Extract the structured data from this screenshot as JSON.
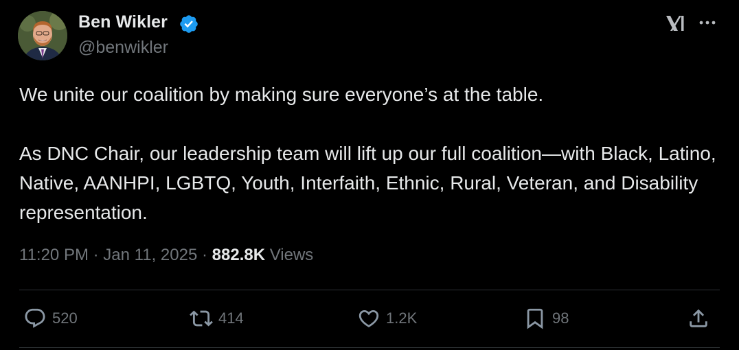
{
  "author": {
    "display_name": "Ben Wikler",
    "handle": "@benwikler"
  },
  "tweet": {
    "paragraphs": [
      "We unite our coalition by making sure everyone’s at the table.",
      "As DNC Chair, our leadership team will lift up our full coalition—with Black, Latino, Native, AANHPI, LGBTQ, Youth, Interfaith, Ethnic, Rural, Veteran, and Disability representation."
    ]
  },
  "meta": {
    "time": "11:20 PM",
    "separator": "·",
    "date": "Jan 11, 2025",
    "views_count": "882.8K",
    "views_label": "Views"
  },
  "actions": {
    "replies": "520",
    "reposts": "414",
    "likes": "1.2K",
    "bookmarks": "98"
  },
  "colors": {
    "background": "#000000",
    "primary_text": "#e7e9ea",
    "secondary_text": "#71767b",
    "verified_badge": "#1d9bf0",
    "divider": "#2f3336"
  },
  "icons": [
    "verified-badge-icon",
    "x-logo-icon",
    "more-icon",
    "reply-icon",
    "repost-icon",
    "like-icon",
    "bookmark-icon",
    "share-icon"
  ]
}
